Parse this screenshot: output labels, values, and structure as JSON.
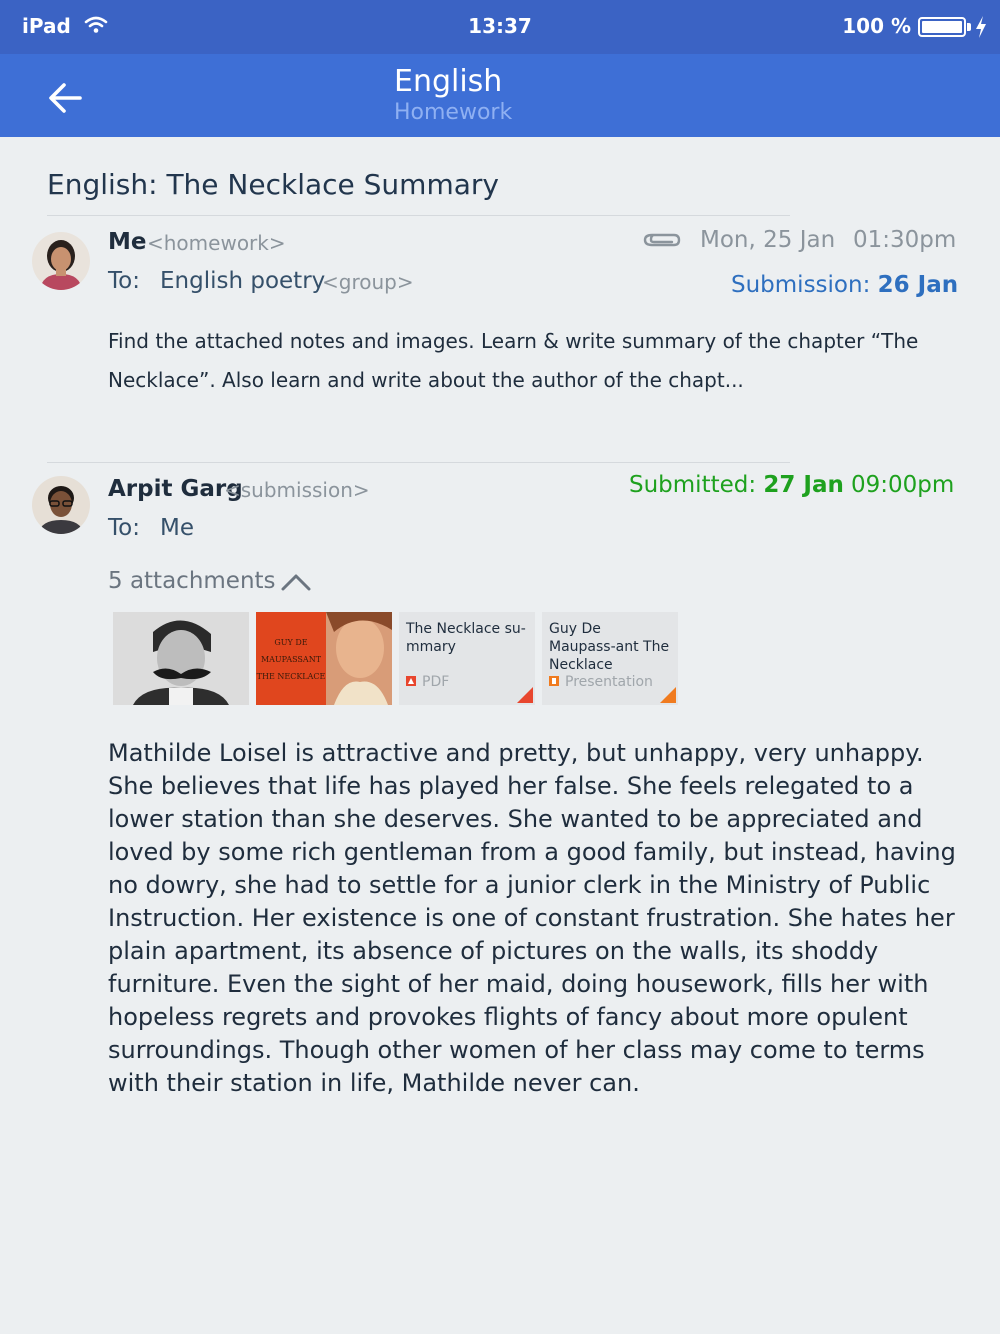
{
  "status_bar": {
    "device": "iPad",
    "time": "13:37",
    "battery": "100 %"
  },
  "app_bar": {
    "title": "English",
    "subtitle": "Homework"
  },
  "subject": "English: The Necklace Summary",
  "homework_message": {
    "sender": "Me",
    "sender_role": "<homework>",
    "to_label": "To:",
    "to_value": "English poetry",
    "to_tag": "<group>",
    "date": "Mon, 25 Jan",
    "time": "01:30pm",
    "submission_label": "Submission:",
    "submission_date": "26 Jan",
    "body": "Find the attached notes and images. Learn & write summary of the chapter  “The Necklace”. Also learn and write about the author of the chapt..."
  },
  "submission_message": {
    "sender": "Arpit Garg",
    "sender_role": "<submission>",
    "to_label": "To:",
    "to_value": "Me",
    "submitted_label": "Submitted:",
    "submitted_date": "27 Jan",
    "submitted_time": "09:00pm",
    "attachments_label": "5 attachments",
    "attachments": [
      {
        "kind": "image",
        "icon": "portrait-image"
      },
      {
        "kind": "image",
        "icon": "book-cover-image",
        "cover_lines": [
          "GUY DE",
          "MAUPASSANT",
          "THE NECKLACE"
        ]
      },
      {
        "kind": "doc",
        "title": "The Necklace su-mmary",
        "type": "PDF",
        "type_color": "#e8462e"
      },
      {
        "kind": "doc",
        "title": "Guy De Maupass-ant The Necklace",
        "type": "Presentation",
        "type_color": "#f07b1f"
      }
    ],
    "body": "Mathilde Loisel is attractive and pretty, but unhappy, very unhappy. She believes that life has played her false. She feels relegated to a lower station than she deserves. She wanted to be appreciated and loved by some rich gentleman from a good family, but instead, having no dowry, she had to settle for a junior clerk in the Ministry of Public Instruction. Her existence is one of constant frustration. She hates her plain apartment, its absence of pictures on the walls, its shoddy furniture. Even the sight of her maid, doing housework, fills her with hopeless regrets and provokes flights of fancy about more opulent surroundings. Though other women of her class may come to terms with their station in life, Mathilde never can."
  },
  "colors": {
    "status_bar": "#3b63c4",
    "app_bar": "#3e6fd6",
    "background": "#eceff1",
    "submitted_green": "#1ea11e",
    "submission_blue": "#2e6fbf"
  }
}
